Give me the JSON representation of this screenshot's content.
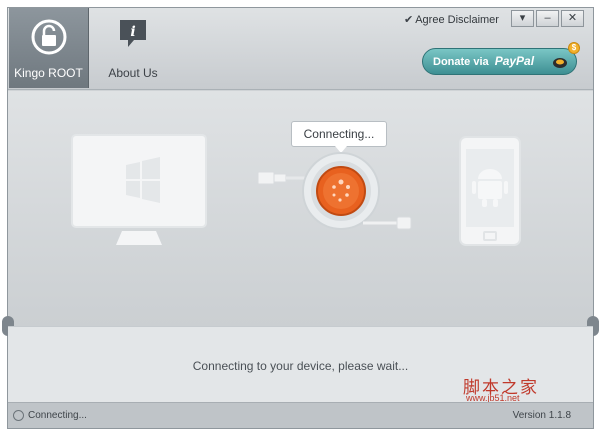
{
  "nav": {
    "items": [
      {
        "label": "Kingo ROOT",
        "icon": "lock-refresh-icon"
      },
      {
        "label": "About Us",
        "icon": "info-speech-icon"
      }
    ]
  },
  "titlebar": {
    "disclaimer": "Agree Disclaimer",
    "menu_icon": "menu-dropdown-icon",
    "minimize": "–",
    "close": "✕"
  },
  "donate": {
    "prefix": "Donate via",
    "brand": "PayPal",
    "coin": "$"
  },
  "stage": {
    "bubble": "Connecting..."
  },
  "status": {
    "message": "Connecting to your device, please wait..."
  },
  "watermark": {
    "text": "脚本之家",
    "url": "www.jb51.net"
  },
  "footer": {
    "status": "Connecting...",
    "version": "Version  1.1.8"
  },
  "colors": {
    "accent": "#e8611f",
    "donate": "#4a9ea1",
    "header": "#d3d7da"
  }
}
